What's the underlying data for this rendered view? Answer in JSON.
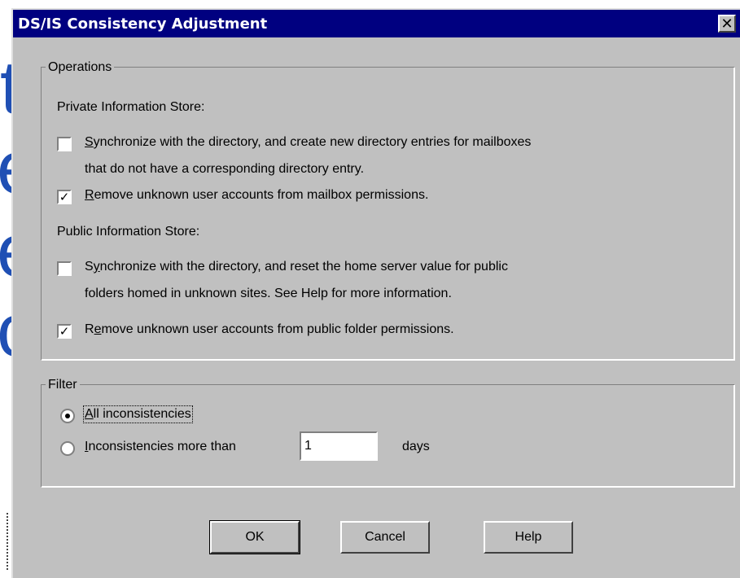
{
  "background": {
    "letters": [
      "t",
      "e",
      "e",
      "c"
    ]
  },
  "dialog": {
    "title": "DS/IS Consistency Adjustment",
    "close_glyph": "✕"
  },
  "operations": {
    "legend": "Operations",
    "private_heading": "Private Information Store:",
    "private_sync": {
      "checked": false,
      "mnemonic": "S",
      "label_rest": "ynchronize with the directory, and create new directory entries for mailboxes",
      "label_line2": "that do not have a corresponding directory entry."
    },
    "private_remove": {
      "checked": true,
      "mnemonic": "R",
      "label_rest": "emove unknown user accounts from mailbox permissions."
    },
    "public_heading": "Public Information Store:",
    "public_sync": {
      "checked": false,
      "prefix": "S",
      "mnemonic": "y",
      "label_rest": "nchronize with the directory, and reset the home server value for public",
      "label_line2": "folders homed in unknown sites. See Help for more information."
    },
    "public_remove": {
      "checked": true,
      "prefix": "R",
      "mnemonic": "e",
      "label_rest": "move unknown user accounts from public folder permissions."
    }
  },
  "filter": {
    "legend": "Filter",
    "all": {
      "selected": true,
      "mnemonic": "A",
      "label_rest": "ll inconsistencies"
    },
    "more_than": {
      "selected": false,
      "mnemonic": "I",
      "label_rest": "nconsistencies more than"
    },
    "days_value": "1",
    "days_label": "days"
  },
  "buttons": {
    "ok": "OK",
    "cancel": "Cancel",
    "help": "Help"
  },
  "check_glyph": "✓"
}
